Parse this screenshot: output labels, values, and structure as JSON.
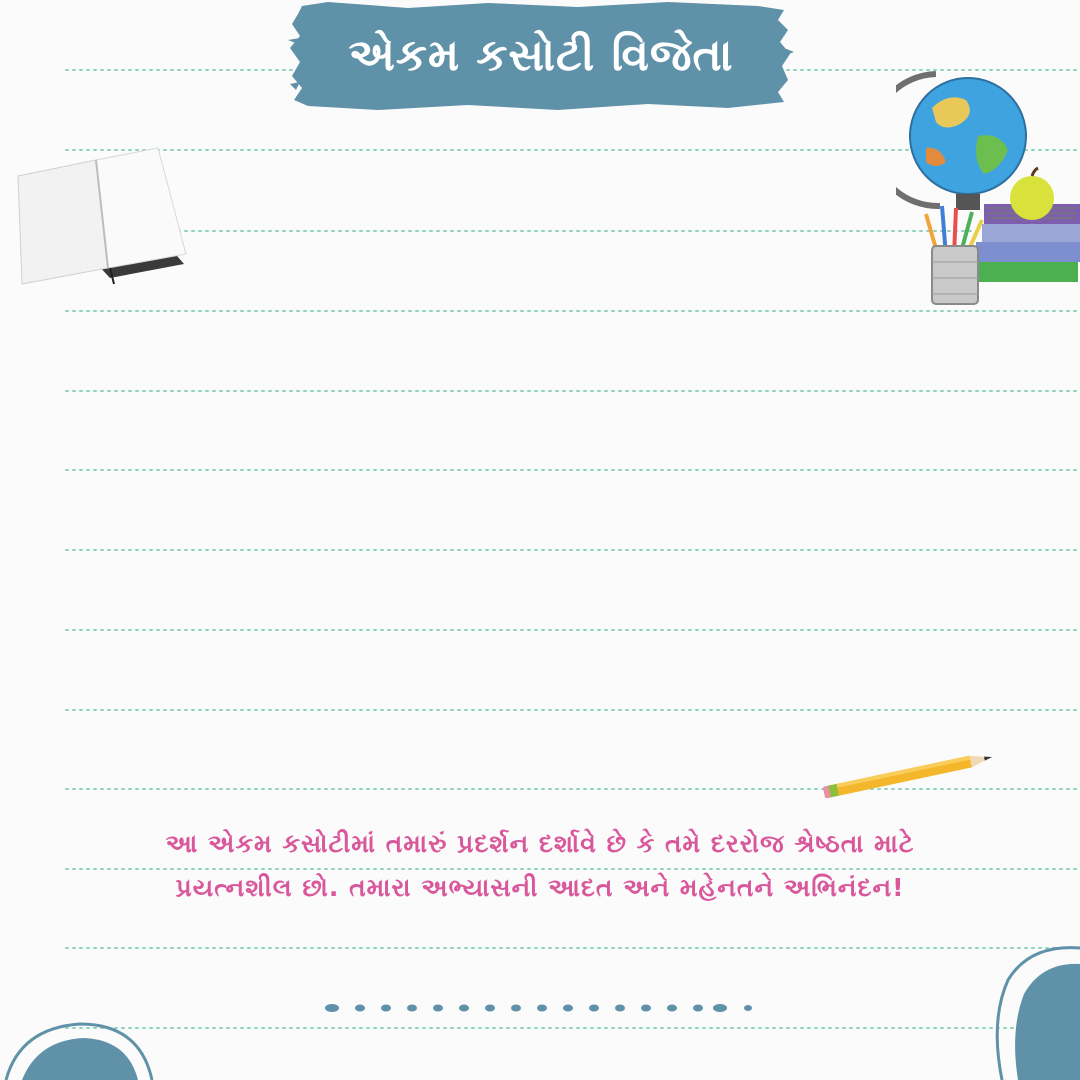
{
  "header": {
    "title": "એકમ કસોટી વિજેતા"
  },
  "message": {
    "line1": "આ એકમ કસોટીમાં તમારું પ્રદર્શન દર્શાવે છે કે તમે દરરોજ શ્રેષ્ઠતા માટે",
    "line2": "પ્રયત્નશીલ છો. તમારા અભ્યાસની આદત અને મહેનતને અભિનંદન!"
  },
  "decorations": {
    "left": "open-book-icon",
    "right": "globe-and-school-supplies-icon",
    "pencil": "pencil-icon"
  },
  "colors": {
    "banner": "#5f91a9",
    "message_text": "#d9589c",
    "ruled_line": "#8fd3bd",
    "background": "#fbfbfb"
  }
}
